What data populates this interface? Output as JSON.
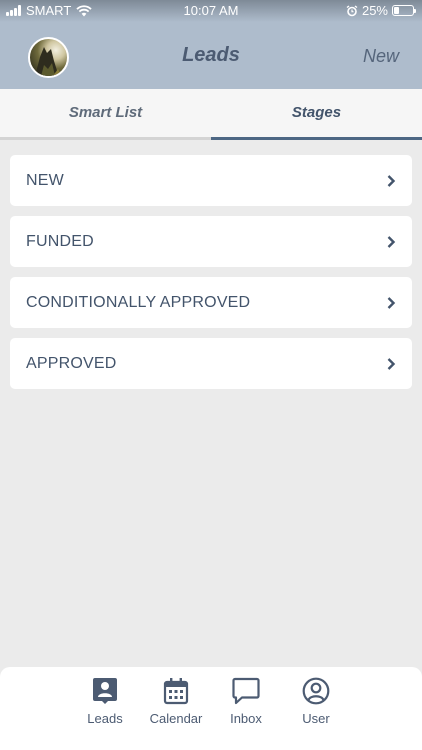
{
  "status_bar": {
    "carrier": "SMART",
    "time": "10:07 AM",
    "battery": "25%",
    "battery_level": 0.25,
    "icons": [
      "signal-icon",
      "wifi-icon",
      "alarm-icon",
      "battery-icon"
    ]
  },
  "nav": {
    "title": "Leads",
    "new_label": "New",
    "avatar_icon": "profile-avatar"
  },
  "tabs": [
    {
      "label": "Smart List",
      "active": false
    },
    {
      "label": "Stages",
      "active": true
    }
  ],
  "stages": [
    {
      "label": "NEW",
      "icon": "chevron-right-icon"
    },
    {
      "label": "FUNDED",
      "icon": "chevron-right-icon"
    },
    {
      "label": "CONDITIONALLY APPROVED",
      "icon": "chevron-right-icon"
    },
    {
      "label": "APPROVED",
      "icon": "chevron-right-icon"
    }
  ],
  "tab_bar": [
    {
      "label": "Leads",
      "icon": "contact-card-icon"
    },
    {
      "label": "Calendar",
      "icon": "calendar-icon"
    },
    {
      "label": "Inbox",
      "icon": "chat-bubble-icon"
    },
    {
      "label": "User",
      "icon": "user-circle-icon"
    }
  ],
  "colors": {
    "header": "#aebccc",
    "accent": "#43546b",
    "background": "#ebebeb",
    "active_tab_underline": "#4d6784"
  }
}
